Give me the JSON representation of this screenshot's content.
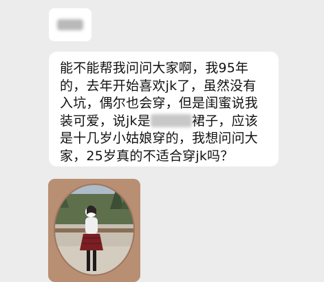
{
  "chat": {
    "sender_name_redacted": true,
    "message": {
      "part1": "能不能帮我问问大家啊，我95年的，去年开始喜欢jk了，虽然没有入坑，偶尔也会穿，但是闺蜜说我装可爱，说jk是",
      "part2": "裙子，应该是十几岁小姑娘穿的，我想问问大家，25岁真的不适合穿jk吗？"
    },
    "image": {
      "description_icon": "photo-thumbnail"
    }
  },
  "colors": {
    "background": "#ececec",
    "bubble": "#ffffff",
    "text": "#111111"
  }
}
